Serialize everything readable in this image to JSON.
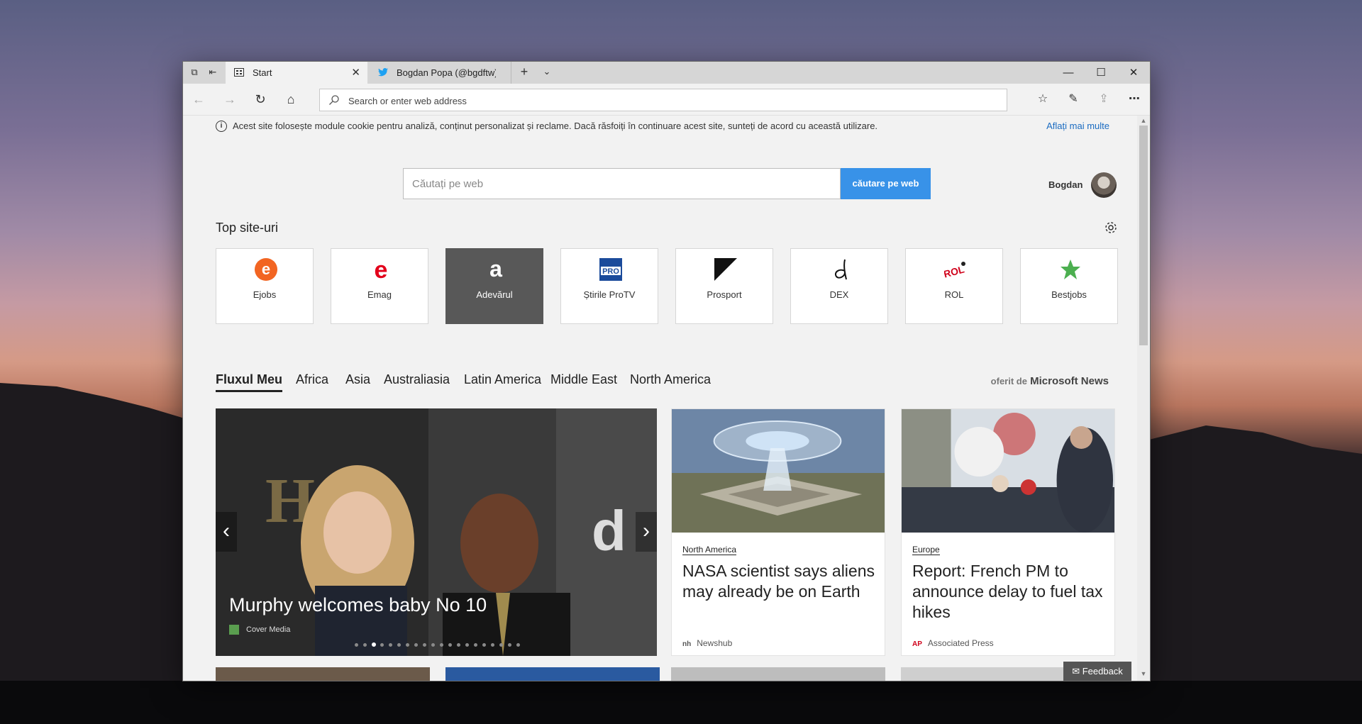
{
  "browser": {
    "tabs": [
      {
        "label": "Start",
        "icon": "start-page-icon",
        "active": true
      },
      {
        "label": "Bogdan Popa (@bgdftw) | T",
        "icon": "twitter-icon",
        "active": false
      }
    ],
    "address_placeholder": "Search or enter web address"
  },
  "cookie_banner": {
    "text": "Acest site folosește module cookie pentru analiză, conținut personalizat și reclame. Dacă răsfoiți în continuare acest site, sunteți de acord cu această utilizare.",
    "link": "Aflați mai multe"
  },
  "search": {
    "placeholder": "Căutați pe web",
    "button": "căutare pe web"
  },
  "user": {
    "name": "Bogdan"
  },
  "top_sites": {
    "title": "Top site-uri",
    "items": [
      {
        "label": "Ejobs",
        "icon": "ejobs-logo",
        "color": "#f26522"
      },
      {
        "label": "Emag",
        "icon": "emag-logo",
        "color": "#e3001b"
      },
      {
        "label": "Adevărul",
        "icon": "adevarul-logo",
        "color": "#585858"
      },
      {
        "label": "Știrile ProTV",
        "icon": "protv-logo",
        "color": "#1b4b9b"
      },
      {
        "label": "Prosport",
        "icon": "prosport-logo",
        "color": "#111111"
      },
      {
        "label": "DEX",
        "icon": "dex-logo",
        "color": "#111111"
      },
      {
        "label": "ROL",
        "icon": "rol-logo",
        "color": "#d0021b"
      },
      {
        "label": "Bestjobs",
        "icon": "bestjobs-logo",
        "color": "#4caf50"
      }
    ]
  },
  "feed": {
    "tabs": [
      "Fluxul Meu",
      "Africa",
      "Asia",
      "Australiasia",
      "Latin America",
      "Middle East",
      "North America"
    ],
    "powered_by_prefix": "oferit de",
    "powered_by_brand": "Microsoft News",
    "hero": {
      "title": "Murphy welcomes baby No 10",
      "source": "Cover Media",
      "dot_count": 20,
      "active_dot": 2
    },
    "cards": [
      {
        "category": "North America",
        "title": "NASA scientist says aliens may already be on Earth",
        "source": "Newshub",
        "source_logo": "nh"
      },
      {
        "category": "Europe",
        "title": "Report: French PM to announce delay to fuel tax hikes",
        "source": "Associated Press",
        "source_logo": "AP"
      }
    ]
  },
  "feedback": {
    "label": "Feedback"
  }
}
